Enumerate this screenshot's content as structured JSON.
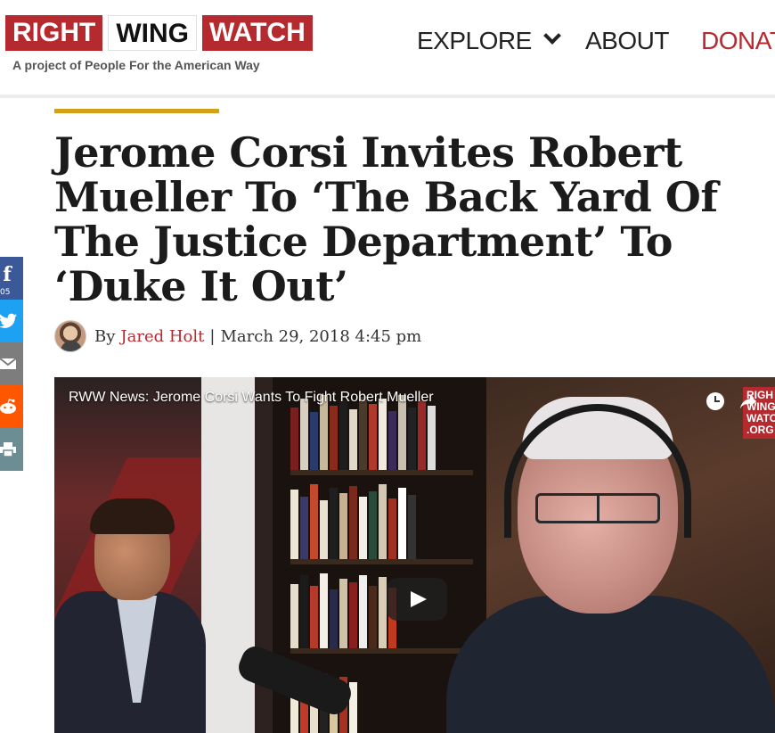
{
  "header": {
    "logo_words": [
      "RIGHT",
      "WING",
      "WATCH"
    ],
    "tagline": "A project of People For the American Way",
    "nav": {
      "explore": "EXPLORE",
      "about": "ABOUT",
      "donate": "DONATE"
    }
  },
  "colors": {
    "brand_red": "#b52a2f",
    "accent_gold": "#d4a017"
  },
  "article": {
    "title": "Jerome Corsi Invites Robert Mueller To ‘The Back Yard Of The Justice Department’ To ‘Duke It Out’",
    "byline_prefix": "By",
    "author": "Jared Holt",
    "separator": "|",
    "date": "March 29, 2018 4:45 pm"
  },
  "share": {
    "facebook_icon": "f",
    "facebook_count": "05",
    "items": [
      "facebook-icon",
      "twitter-icon",
      "mail-icon",
      "reddit-icon",
      "print-icon"
    ]
  },
  "video": {
    "title": "RWW News: Jerome Corsi Wants To Fight Robert Mueller",
    "channel_logo_lines": [
      "RIGH",
      "WING",
      "WATC",
      ".ORG"
    ]
  }
}
